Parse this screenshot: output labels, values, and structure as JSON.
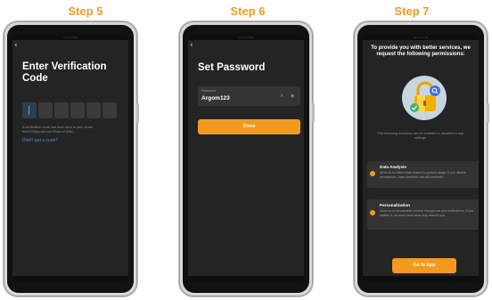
{
  "steps": [
    {
      "title": "Step 5",
      "status_text": "Verizon 9:41",
      "heading": "Enter Verification Code",
      "code_boxes": 6,
      "info": "A verification code has been sent to your email test123@gmail.com Resend (54s)",
      "link": "Didn't get a code?"
    },
    {
      "title": "Step 6",
      "status_text": "Verizon 9:41",
      "heading": "Set Password",
      "password_label": "Password",
      "password_value": "Argom123",
      "clear_icon": "×",
      "eye_icon": "◉",
      "button": "Done"
    },
    {
      "title": "Step 7",
      "status_text": "Verizon 9:41",
      "heading": "To provide you with better services, we request the following permissions:",
      "caption": "The following functions can be enabled or disabled in app settings.",
      "permissions": [
        {
          "title": "Data Analysis",
          "desc": "Allow us to collect data related to product usage. If you disable permissions, basic functions are still available."
        },
        {
          "title": "Personalization",
          "desc": "Allow us to recommend content through ads and notifications. If you disable it, we won't send what may interest you."
        }
      ],
      "button": "Go to App"
    }
  ],
  "colors": {
    "accent": "#f29a1f",
    "screen_bg": "#242424",
    "link": "#4a8fd6"
  }
}
